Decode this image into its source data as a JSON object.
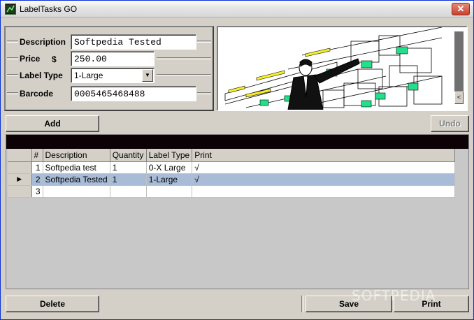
{
  "window": {
    "title": "LabelTasks GO",
    "close_glyph": "✕"
  },
  "form": {
    "description_label": "Description",
    "description_value": "Softpedia Tested",
    "price_label": "Price",
    "price_currency": "$",
    "price_value": "250.00",
    "label_type_label": "Label Type",
    "label_type_value": "1-Large",
    "barcode_label": "Barcode",
    "barcode_value": "0005465468488"
  },
  "buttons": {
    "add": "Add",
    "undo": "Undo",
    "delete": "Delete",
    "save": "Save",
    "print": "Print"
  },
  "grid": {
    "headers": [
      "#",
      "Description",
      "Quantity",
      "Label Type",
      "Print"
    ],
    "rows": [
      {
        "num": "1",
        "description": "Softpedia test",
        "quantity": "1",
        "label_type": "0-X Large",
        "print": "√"
      },
      {
        "num": "2",
        "description": "Softpedia Tested",
        "quantity": "1",
        "label_type": "1-Large",
        "print": "√"
      },
      {
        "num": "3",
        "description": "",
        "quantity": "",
        "label_type": "",
        "print": ""
      }
    ],
    "selected_row": 2
  },
  "icons": {
    "app": "labeltasks-app-icon",
    "row_pointer": "▶",
    "dropdown": "▼",
    "scroll": "<"
  },
  "watermark": "SOFTPEDIA",
  "colors": {
    "selection": "#a8bcd8",
    "grid_band": "#0c0206",
    "label_yellow": "#f5ee2a",
    "label_green": "#22e08a"
  }
}
